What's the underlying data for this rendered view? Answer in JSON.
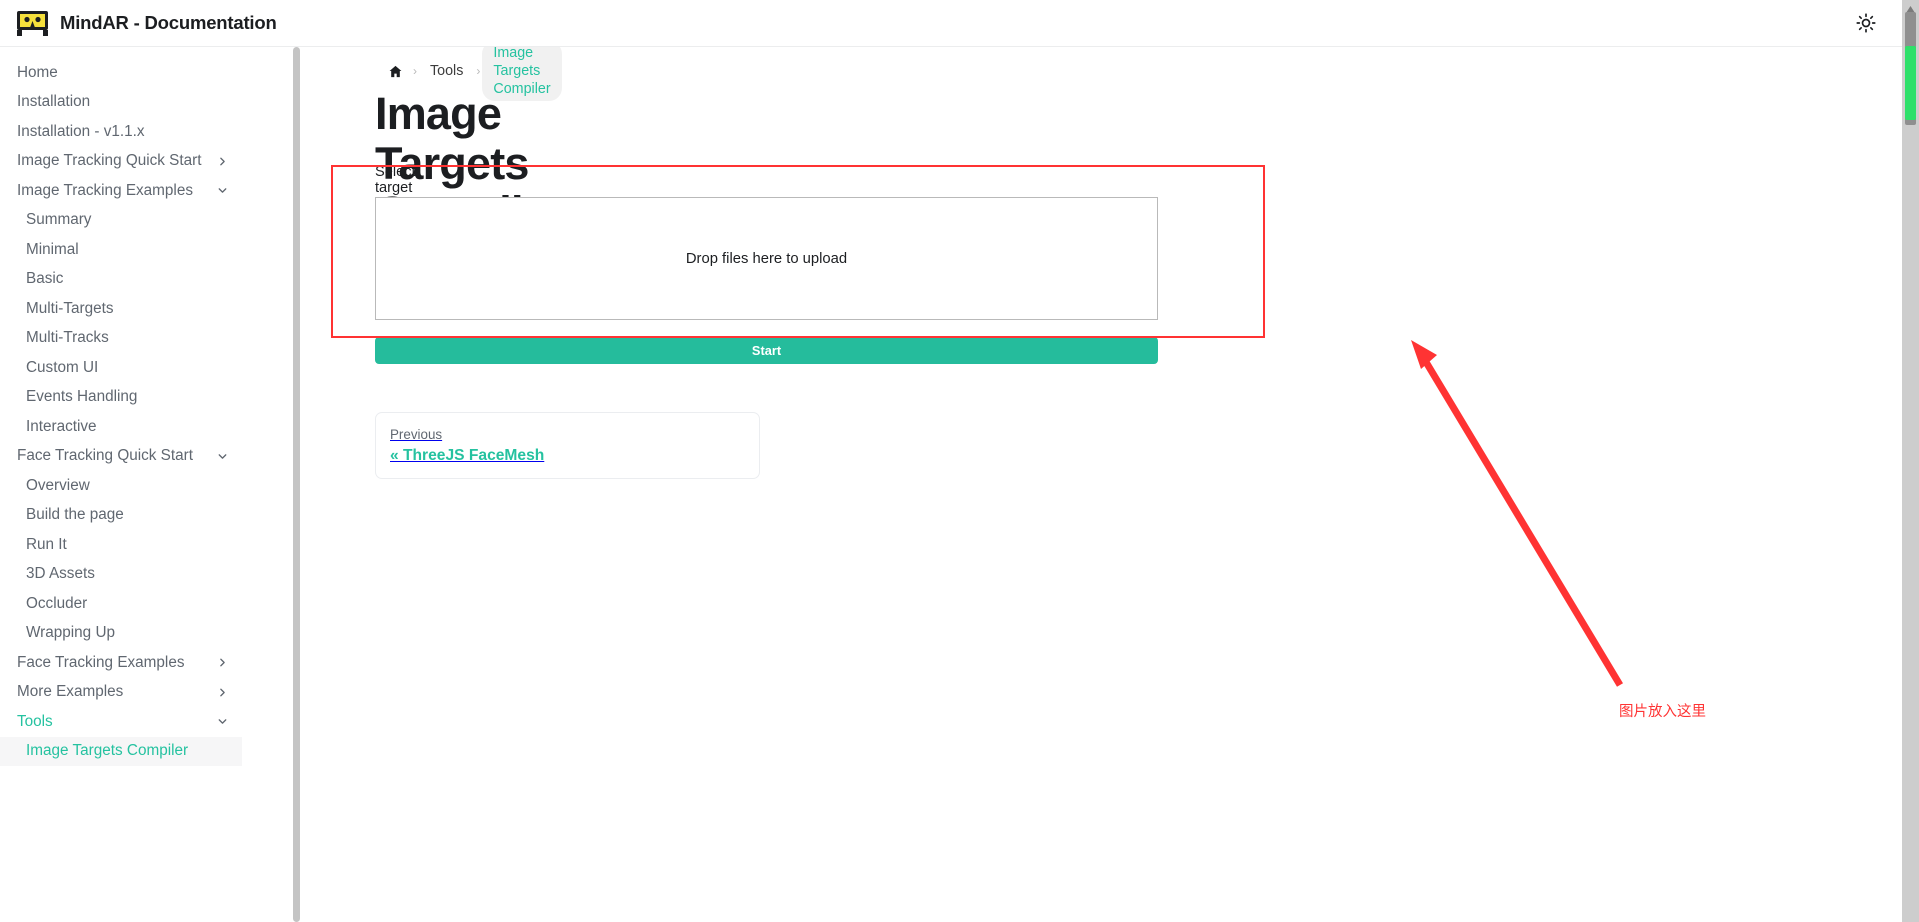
{
  "navbar": {
    "brand_title": "MindAR - Documentation",
    "logo_icon": "mindar-glasses-logo",
    "theme_toggle_icon": "sun-icon"
  },
  "sidebar": {
    "items": [
      {
        "label": "Home",
        "indent": false,
        "state": "default",
        "chevron": "none"
      },
      {
        "label": "Installation",
        "indent": false,
        "state": "default",
        "chevron": "none"
      },
      {
        "label": "Installation - v1.1.x",
        "indent": false,
        "state": "default",
        "chevron": "none"
      },
      {
        "label": "Image Tracking Quick Start",
        "indent": false,
        "state": "default",
        "chevron": "right"
      },
      {
        "label": "Image Tracking Examples",
        "indent": false,
        "state": "default",
        "chevron": "down"
      },
      {
        "label": "Summary",
        "indent": true,
        "state": "default",
        "chevron": "none"
      },
      {
        "label": "Minimal",
        "indent": true,
        "state": "default",
        "chevron": "none"
      },
      {
        "label": "Basic",
        "indent": true,
        "state": "default",
        "chevron": "none"
      },
      {
        "label": "Multi-Targets",
        "indent": true,
        "state": "default",
        "chevron": "none"
      },
      {
        "label": "Multi-Tracks",
        "indent": true,
        "state": "default",
        "chevron": "none"
      },
      {
        "label": "Custom UI",
        "indent": true,
        "state": "default",
        "chevron": "none"
      },
      {
        "label": "Events Handling",
        "indent": true,
        "state": "default",
        "chevron": "none"
      },
      {
        "label": "Interactive",
        "indent": true,
        "state": "default",
        "chevron": "none"
      },
      {
        "label": "Face Tracking Quick Start",
        "indent": false,
        "state": "default",
        "chevron": "down"
      },
      {
        "label": "Overview",
        "indent": true,
        "state": "default",
        "chevron": "none"
      },
      {
        "label": "Build the page",
        "indent": true,
        "state": "default",
        "chevron": "none"
      },
      {
        "label": "Run It",
        "indent": true,
        "state": "default",
        "chevron": "none"
      },
      {
        "label": "3D Assets",
        "indent": true,
        "state": "default",
        "chevron": "none"
      },
      {
        "label": "Occluder",
        "indent": true,
        "state": "default",
        "chevron": "none"
      },
      {
        "label": "Wrapping Up",
        "indent": true,
        "state": "default",
        "chevron": "none"
      },
      {
        "label": "Face Tracking Examples",
        "indent": false,
        "state": "default",
        "chevron": "right"
      },
      {
        "label": "More Examples",
        "indent": false,
        "state": "default",
        "chevron": "right"
      },
      {
        "label": "Tools",
        "indent": false,
        "state": "active-cat",
        "chevron": "down"
      },
      {
        "label": "Image Targets Compiler",
        "indent": true,
        "state": "active-page",
        "chevron": "none"
      }
    ]
  },
  "breadcrumb": {
    "home_icon": "home-icon",
    "items": [
      {
        "label": "Tools",
        "current": false
      },
      {
        "label": "Image Targets Compiler",
        "current": true
      }
    ],
    "separator": "›"
  },
  "main": {
    "page_title": "Image Targets Compiler",
    "compiler": {
      "section_label": "Select target images and start",
      "dropzone_text": "Drop files here to upload",
      "start_label": "Start",
      "start_color": "#25bc9c"
    },
    "pagination": {
      "prev_label": "Previous",
      "prev_link": "« ThreeJS FaceMesh",
      "prev_link_color": "#25c2a0"
    }
  },
  "annotation": {
    "note_text": "图片放入这里",
    "color": "#ff3333",
    "rect_name": "highlight-rectangle",
    "arrow_name": "pointer-arrow"
  },
  "scrollbars": {
    "window_thumb_color": "#2ee06a",
    "window_track_color": "#cdcdcd"
  }
}
